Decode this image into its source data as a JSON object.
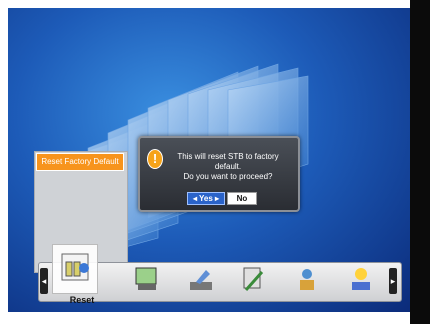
{
  "menu": {
    "selected_label": "Reset",
    "items": [
      {
        "name": "reset",
        "label": "Reset"
      },
      {
        "name": "network",
        "label": ""
      },
      {
        "name": "satellite",
        "label": ""
      },
      {
        "name": "tools",
        "label": ""
      },
      {
        "name": "user",
        "label": ""
      },
      {
        "name": "upgrade",
        "label": ""
      }
    ]
  },
  "tooltip": {
    "title": "Reset Factory Default"
  },
  "dialog": {
    "message_line1": "This will reset STB to factory default.",
    "message_line2": "Do you want to proceed?",
    "yes_label": "◂ Yes ▸",
    "no_label": "No"
  },
  "colors": {
    "accent": "#f7941d",
    "dialog_bg": "#3a3e44",
    "yes_bg": "#2a63c9",
    "background": "#1d5bb8"
  }
}
